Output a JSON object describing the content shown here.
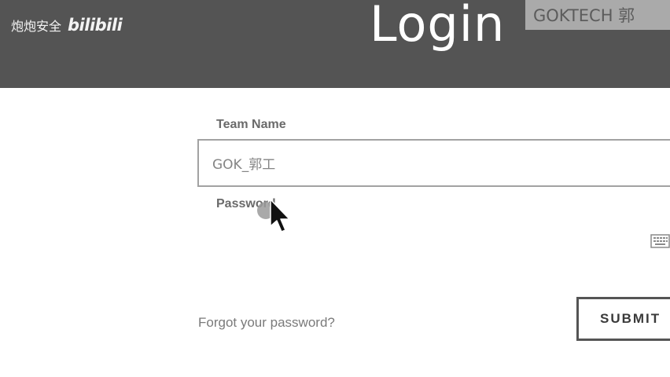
{
  "header": {
    "watermark_left_text": "炮炮安全",
    "watermark_left_logo": "bilibili",
    "title": "Login",
    "watermark_right_text": "GOKTECH 郭"
  },
  "form": {
    "team_label": "Team Name",
    "team_value": "GOK_郭工",
    "password_label": "Password",
    "password_value": "",
    "keyboard_icon": "keyboard-icon"
  },
  "actions": {
    "forgot_link": "Forgot your password?",
    "submit_label": "SUBMIT"
  },
  "colors": {
    "header_bg": "#545454",
    "page_bg": "#ffffff"
  },
  "cursor": "mouse-pointer-icon"
}
